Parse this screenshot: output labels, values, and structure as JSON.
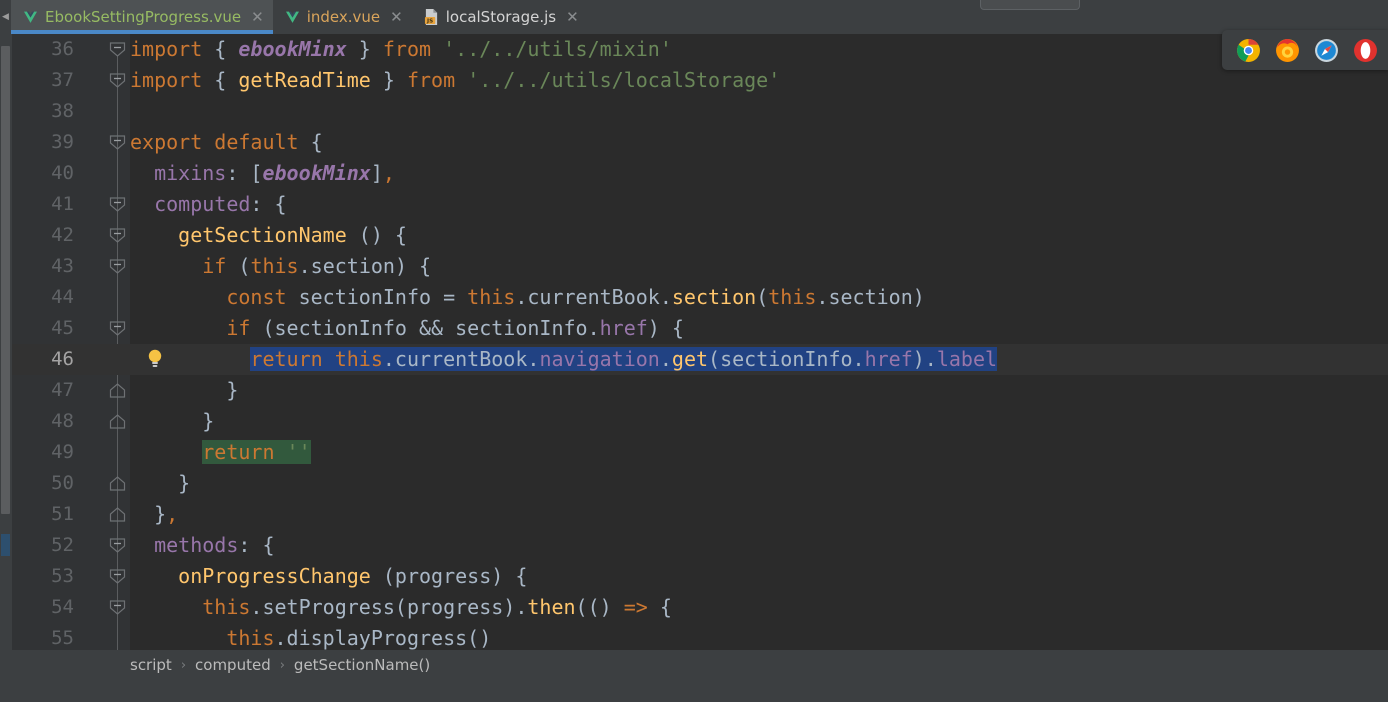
{
  "window": {
    "app": "WebStorm Editor"
  },
  "tabs": {
    "scroll_left_icon": "chevron-left-icon",
    "items": [
      {
        "label": "EbookSettingProgress.vue",
        "icon": "vue-file-icon",
        "close_icon": "close-icon",
        "active": true,
        "color_class": "green"
      },
      {
        "label": "index.vue",
        "icon": "vue-file-icon",
        "close_icon": "close-icon",
        "active": false,
        "color_class": "orange"
      },
      {
        "label": "localStorage.js",
        "icon": "js-file-icon",
        "close_icon": "close-icon",
        "active": false,
        "color_class": "plain"
      }
    ]
  },
  "editor": {
    "selection_text": "return this.currentBook.navigation.get(sectionInfo.href).label",
    "search_highlight_text": "return ''",
    "caret_line": 46,
    "bulb_icon": "lightbulb-intention-icon",
    "lines": [
      {
        "num": "36",
        "fold": "collapse",
        "segments": [
          {
            "t": "import ",
            "c": "kw"
          },
          {
            "t": "{ ",
            "c": "punc"
          },
          {
            "t": "ebookMinx",
            "c": "itl"
          },
          {
            "t": " } ",
            "c": "punc"
          },
          {
            "t": "from ",
            "c": "kw"
          },
          {
            "t": "'../../utils/mixin'",
            "c": "str"
          }
        ]
      },
      {
        "num": "37",
        "fold": "end",
        "segments": [
          {
            "t": "import ",
            "c": "kw"
          },
          {
            "t": "{ ",
            "c": "punc"
          },
          {
            "t": "getReadTime",
            "c": "fn"
          },
          {
            "t": " } ",
            "c": "punc"
          },
          {
            "t": "from ",
            "c": "kw"
          },
          {
            "t": "'../../utils/localStorage'",
            "c": "str"
          }
        ]
      },
      {
        "num": "38",
        "fold": "none",
        "segments": []
      },
      {
        "num": "39",
        "fold": "collapse",
        "segments": [
          {
            "t": "export default ",
            "c": "kw"
          },
          {
            "t": "{",
            "c": "punc"
          }
        ]
      },
      {
        "num": "40",
        "fold": "none",
        "segments": [
          {
            "t": "  ",
            "c": "punc"
          },
          {
            "t": "mixins",
            "c": "prop"
          },
          {
            "t": ": [",
            "c": "punc"
          },
          {
            "t": "ebookMinx",
            "c": "itl"
          },
          {
            "t": "]",
            "c": "punc"
          },
          {
            "t": ",",
            "c": "kw"
          }
        ]
      },
      {
        "num": "41",
        "fold": "collapse",
        "segments": [
          {
            "t": "  ",
            "c": "punc"
          },
          {
            "t": "computed",
            "c": "prop"
          },
          {
            "t": ": {",
            "c": "punc"
          }
        ]
      },
      {
        "num": "42",
        "fold": "collapse",
        "segments": [
          {
            "t": "    ",
            "c": "punc"
          },
          {
            "t": "getSectionName",
            "c": "fn"
          },
          {
            "t": " () {",
            "c": "punc"
          }
        ]
      },
      {
        "num": "43",
        "fold": "collapse",
        "segments": [
          {
            "t": "      ",
            "c": "punc"
          },
          {
            "t": "if",
            "c": "kw"
          },
          {
            "t": " (",
            "c": "punc"
          },
          {
            "t": "this",
            "c": "kw"
          },
          {
            "t": ".section) {",
            "c": "punc"
          }
        ]
      },
      {
        "num": "44",
        "fold": "none",
        "segments": [
          {
            "t": "        ",
            "c": "punc"
          },
          {
            "t": "const",
            "c": "kw"
          },
          {
            "t": " sectionInfo = ",
            "c": "ident"
          },
          {
            "t": "this",
            "c": "kw"
          },
          {
            "t": ".currentBook.",
            "c": "ident"
          },
          {
            "t": "section",
            "c": "fn"
          },
          {
            "t": "(",
            "c": "punc"
          },
          {
            "t": "this",
            "c": "kw"
          },
          {
            "t": ".section)",
            "c": "ident"
          }
        ]
      },
      {
        "num": "45",
        "fold": "collapse",
        "segments": [
          {
            "t": "        ",
            "c": "punc"
          },
          {
            "t": "if",
            "c": "kw"
          },
          {
            "t": " (sectionInfo && sectionInfo.",
            "c": "ident"
          },
          {
            "t": "href",
            "c": "prop"
          },
          {
            "t": ") {",
            "c": "punc"
          }
        ]
      },
      {
        "num": "46",
        "fold": "none",
        "caret": true,
        "bulb": true,
        "sel_start": 10,
        "segments": [
          {
            "t": "          ",
            "c": "punc"
          },
          {
            "t": "return",
            "c": "kw",
            "sel": true
          },
          {
            "t": " ",
            "c": "ident",
            "sel": true
          },
          {
            "t": "this",
            "c": "kw",
            "sel": true
          },
          {
            "t": ".currentBook.",
            "c": "ident",
            "sel": true
          },
          {
            "t": "navigation",
            "c": "prop",
            "sel": true
          },
          {
            "t": ".",
            "c": "ident",
            "sel": true
          },
          {
            "t": "get",
            "c": "fn",
            "sel": true
          },
          {
            "t": "(sectionInfo.",
            "c": "ident",
            "sel": true
          },
          {
            "t": "href",
            "c": "prop",
            "sel": true
          },
          {
            "t": ")",
            "c": "ident",
            "sel": true
          },
          {
            "t": ".",
            "c": "ident",
            "sel": true
          },
          {
            "t": "label",
            "c": "prop",
            "sel": true
          }
        ]
      },
      {
        "num": "47",
        "fold": "expand",
        "segments": [
          {
            "t": "        }",
            "c": "punc"
          }
        ]
      },
      {
        "num": "48",
        "fold": "expand",
        "segments": [
          {
            "t": "      }",
            "c": "punc"
          }
        ]
      },
      {
        "num": "49",
        "fold": "none",
        "search": true,
        "search_start": 6,
        "segments": [
          {
            "t": "      ",
            "c": "punc"
          },
          {
            "t": "return",
            "c": "kw",
            "sh": true
          },
          {
            "t": " ",
            "c": "ident",
            "sh": true
          },
          {
            "t": "''",
            "c": "str",
            "sh": true
          }
        ]
      },
      {
        "num": "50",
        "fold": "expand",
        "segments": [
          {
            "t": "    }",
            "c": "punc"
          }
        ]
      },
      {
        "num": "51",
        "fold": "expand",
        "segments": [
          {
            "t": "  }",
            "c": "punc"
          },
          {
            "t": ",",
            "c": "kw"
          }
        ]
      },
      {
        "num": "52",
        "fold": "collapse",
        "segments": [
          {
            "t": "  ",
            "c": "punc"
          },
          {
            "t": "methods",
            "c": "prop"
          },
          {
            "t": ": {",
            "c": "punc"
          }
        ]
      },
      {
        "num": "53",
        "fold": "collapse",
        "segments": [
          {
            "t": "    ",
            "c": "punc"
          },
          {
            "t": "onProgressChange",
            "c": "fn"
          },
          {
            "t": " (progress) {",
            "c": "punc"
          }
        ]
      },
      {
        "num": "54",
        "fold": "collapse",
        "segments": [
          {
            "t": "      ",
            "c": "punc"
          },
          {
            "t": "this",
            "c": "kw"
          },
          {
            "t": ".setProgress(progress).",
            "c": "ident"
          },
          {
            "t": "then",
            "c": "fn"
          },
          {
            "t": "(() ",
            "c": "punc"
          },
          {
            "t": "=>",
            "c": "kw"
          },
          {
            "t": " {",
            "c": "punc"
          }
        ]
      },
      {
        "num": "55",
        "fold": "none",
        "clipped": true,
        "segments": [
          {
            "t": "        ",
            "c": "punc"
          },
          {
            "t": "this",
            "c": "kw"
          },
          {
            "t": ".displayProgress()",
            "c": "ident"
          }
        ]
      }
    ]
  },
  "preview": {
    "browsers": [
      {
        "name": "chrome-icon",
        "color": "#4285f4"
      },
      {
        "name": "firefox-icon",
        "color": "#ff7139"
      },
      {
        "name": "safari-icon",
        "color": "#1b88ca"
      },
      {
        "name": "opera-icon",
        "color": "#e1322e"
      }
    ]
  },
  "breadcrumb": {
    "separator": "›",
    "items": [
      {
        "label": "script"
      },
      {
        "label": "computed"
      },
      {
        "label": "getSectionName()"
      }
    ]
  }
}
